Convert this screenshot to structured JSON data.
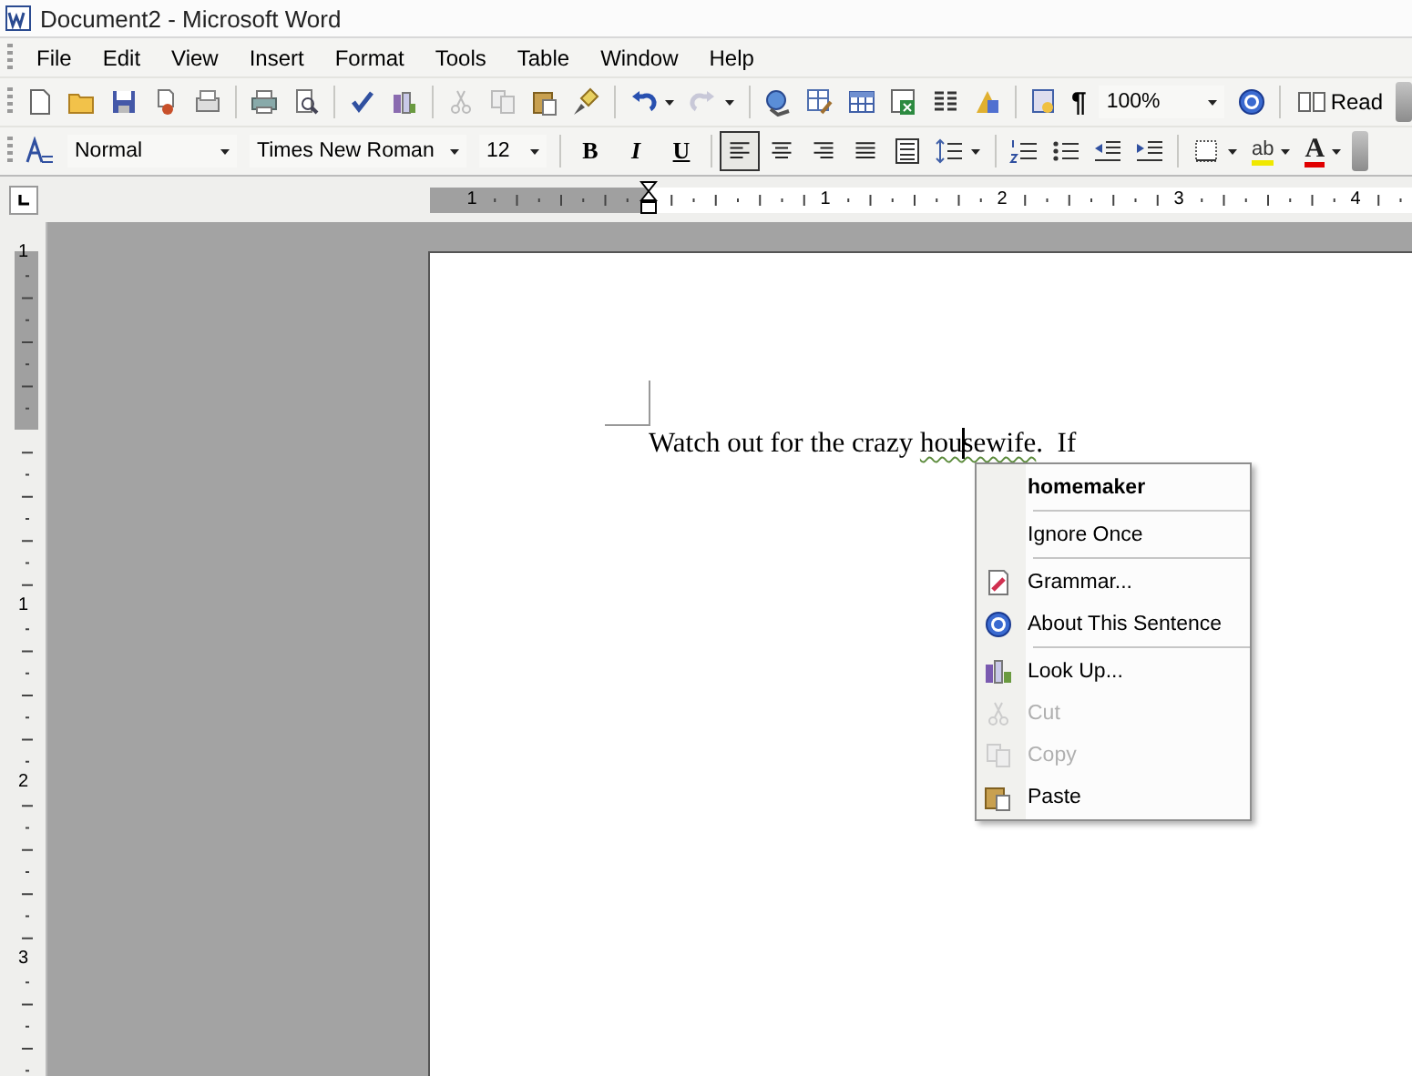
{
  "window": {
    "title": "Document2 - Microsoft Word"
  },
  "menu": [
    "File",
    "Edit",
    "View",
    "Insert",
    "Format",
    "Tools",
    "Table",
    "Window",
    "Help"
  ],
  "standard_toolbar": {
    "show_hide": "¶",
    "zoom": "100%",
    "read_button": "Read"
  },
  "formatting_toolbar": {
    "style": "Normal",
    "font": "Times New Roman",
    "size": "12",
    "bold": "B",
    "italic": "I",
    "underline": "U",
    "alignment": [
      {
        "selected": true
      },
      {
        "selected": false
      },
      {
        "selected": false
      },
      {
        "selected": false
      }
    ],
    "highlight": "ab",
    "font_color": "A"
  },
  "ruler": {
    "labels": [
      "1",
      "1",
      "2",
      "3",
      "4"
    ]
  },
  "vertical_ruler": {
    "labels": [
      "1",
      "1",
      "2",
      "3"
    ]
  },
  "document": {
    "segments": [
      {
        "text": "Watch out for the crazy ",
        "flagged": false
      },
      {
        "text": "housewife",
        "flagged": true
      },
      {
        "text": ".  If",
        "flagged": false
      }
    ]
  },
  "context_menu": [
    {
      "label": "homemaker",
      "kind": "suggestion",
      "separator_before": false,
      "disabled": false
    },
    {
      "label": "Ignore Once",
      "kind": "command",
      "separator_before": true,
      "disabled": false
    },
    {
      "label": "Grammar...",
      "kind": "command",
      "separator_before": true,
      "disabled": false
    },
    {
      "label": "About This Sentence",
      "kind": "command",
      "separator_before": false,
      "disabled": false
    },
    {
      "label": "Look Up...",
      "kind": "command",
      "separator_before": true,
      "disabled": false
    },
    {
      "label": "Cut",
      "kind": "command",
      "separator_before": false,
      "disabled": true
    },
    {
      "label": "Copy",
      "kind": "command",
      "separator_before": false,
      "disabled": true
    },
    {
      "label": "Paste",
      "kind": "command",
      "separator_before": false,
      "disabled": false
    }
  ]
}
